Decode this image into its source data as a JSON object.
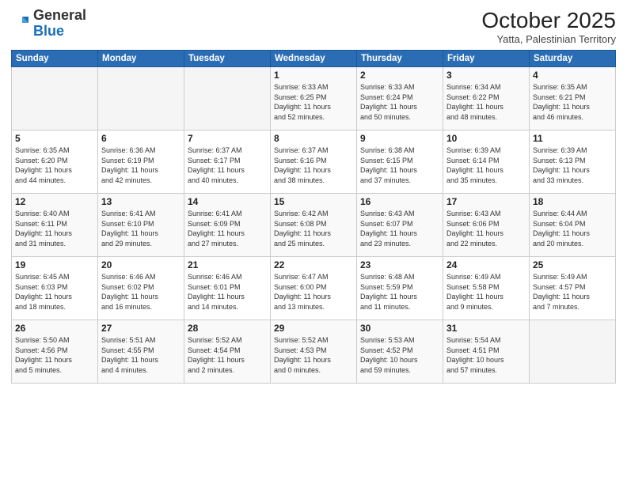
{
  "header": {
    "logo_general": "General",
    "logo_blue": "Blue",
    "month": "October 2025",
    "location": "Yatta, Palestinian Territory"
  },
  "weekdays": [
    "Sunday",
    "Monday",
    "Tuesday",
    "Wednesday",
    "Thursday",
    "Friday",
    "Saturday"
  ],
  "weeks": [
    [
      {
        "day": "",
        "info": ""
      },
      {
        "day": "",
        "info": ""
      },
      {
        "day": "",
        "info": ""
      },
      {
        "day": "1",
        "info": "Sunrise: 6:33 AM\nSunset: 6:25 PM\nDaylight: 11 hours\nand 52 minutes."
      },
      {
        "day": "2",
        "info": "Sunrise: 6:33 AM\nSunset: 6:24 PM\nDaylight: 11 hours\nand 50 minutes."
      },
      {
        "day": "3",
        "info": "Sunrise: 6:34 AM\nSunset: 6:22 PM\nDaylight: 11 hours\nand 48 minutes."
      },
      {
        "day": "4",
        "info": "Sunrise: 6:35 AM\nSunset: 6:21 PM\nDaylight: 11 hours\nand 46 minutes."
      }
    ],
    [
      {
        "day": "5",
        "info": "Sunrise: 6:35 AM\nSunset: 6:20 PM\nDaylight: 11 hours\nand 44 minutes."
      },
      {
        "day": "6",
        "info": "Sunrise: 6:36 AM\nSunset: 6:19 PM\nDaylight: 11 hours\nand 42 minutes."
      },
      {
        "day": "7",
        "info": "Sunrise: 6:37 AM\nSunset: 6:17 PM\nDaylight: 11 hours\nand 40 minutes."
      },
      {
        "day": "8",
        "info": "Sunrise: 6:37 AM\nSunset: 6:16 PM\nDaylight: 11 hours\nand 38 minutes."
      },
      {
        "day": "9",
        "info": "Sunrise: 6:38 AM\nSunset: 6:15 PM\nDaylight: 11 hours\nand 37 minutes."
      },
      {
        "day": "10",
        "info": "Sunrise: 6:39 AM\nSunset: 6:14 PM\nDaylight: 11 hours\nand 35 minutes."
      },
      {
        "day": "11",
        "info": "Sunrise: 6:39 AM\nSunset: 6:13 PM\nDaylight: 11 hours\nand 33 minutes."
      }
    ],
    [
      {
        "day": "12",
        "info": "Sunrise: 6:40 AM\nSunset: 6:11 PM\nDaylight: 11 hours\nand 31 minutes."
      },
      {
        "day": "13",
        "info": "Sunrise: 6:41 AM\nSunset: 6:10 PM\nDaylight: 11 hours\nand 29 minutes."
      },
      {
        "day": "14",
        "info": "Sunrise: 6:41 AM\nSunset: 6:09 PM\nDaylight: 11 hours\nand 27 minutes."
      },
      {
        "day": "15",
        "info": "Sunrise: 6:42 AM\nSunset: 6:08 PM\nDaylight: 11 hours\nand 25 minutes."
      },
      {
        "day": "16",
        "info": "Sunrise: 6:43 AM\nSunset: 6:07 PM\nDaylight: 11 hours\nand 23 minutes."
      },
      {
        "day": "17",
        "info": "Sunrise: 6:43 AM\nSunset: 6:06 PM\nDaylight: 11 hours\nand 22 minutes."
      },
      {
        "day": "18",
        "info": "Sunrise: 6:44 AM\nSunset: 6:04 PM\nDaylight: 11 hours\nand 20 minutes."
      }
    ],
    [
      {
        "day": "19",
        "info": "Sunrise: 6:45 AM\nSunset: 6:03 PM\nDaylight: 11 hours\nand 18 minutes."
      },
      {
        "day": "20",
        "info": "Sunrise: 6:46 AM\nSunset: 6:02 PM\nDaylight: 11 hours\nand 16 minutes."
      },
      {
        "day": "21",
        "info": "Sunrise: 6:46 AM\nSunset: 6:01 PM\nDaylight: 11 hours\nand 14 minutes."
      },
      {
        "day": "22",
        "info": "Sunrise: 6:47 AM\nSunset: 6:00 PM\nDaylight: 11 hours\nand 13 minutes."
      },
      {
        "day": "23",
        "info": "Sunrise: 6:48 AM\nSunset: 5:59 PM\nDaylight: 11 hours\nand 11 minutes."
      },
      {
        "day": "24",
        "info": "Sunrise: 6:49 AM\nSunset: 5:58 PM\nDaylight: 11 hours\nand 9 minutes."
      },
      {
        "day": "25",
        "info": "Sunrise: 5:49 AM\nSunset: 4:57 PM\nDaylight: 11 hours\nand 7 minutes."
      }
    ],
    [
      {
        "day": "26",
        "info": "Sunrise: 5:50 AM\nSunset: 4:56 PM\nDaylight: 11 hours\nand 5 minutes."
      },
      {
        "day": "27",
        "info": "Sunrise: 5:51 AM\nSunset: 4:55 PM\nDaylight: 11 hours\nand 4 minutes."
      },
      {
        "day": "28",
        "info": "Sunrise: 5:52 AM\nSunset: 4:54 PM\nDaylight: 11 hours\nand 2 minutes."
      },
      {
        "day": "29",
        "info": "Sunrise: 5:52 AM\nSunset: 4:53 PM\nDaylight: 11 hours\nand 0 minutes."
      },
      {
        "day": "30",
        "info": "Sunrise: 5:53 AM\nSunset: 4:52 PM\nDaylight: 10 hours\nand 59 minutes."
      },
      {
        "day": "31",
        "info": "Sunrise: 5:54 AM\nSunset: 4:51 PM\nDaylight: 10 hours\nand 57 minutes."
      },
      {
        "day": "",
        "info": ""
      }
    ]
  ]
}
